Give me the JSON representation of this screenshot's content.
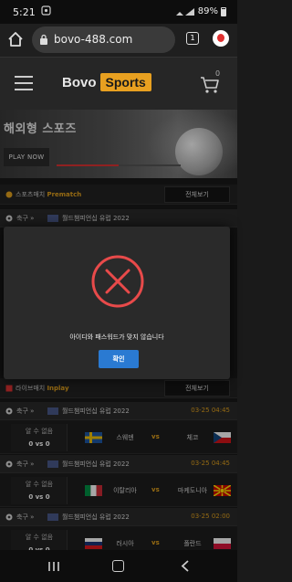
{
  "status_bar": {
    "time": "5:21",
    "battery": "89%"
  },
  "browser": {
    "url": "bovo-488.com",
    "tab_count": "1"
  },
  "header": {
    "logo_left": "Bovo",
    "logo_right": "Sports",
    "cart_count": "0"
  },
  "banner": {
    "title": "해외형 스포즈",
    "cta": "PLAY NOW",
    "progress": 0.5
  },
  "prematch": {
    "label": "스포츠매치",
    "label_en": "Prematch",
    "more": "전체보기",
    "league": {
      "sport": "축구",
      "name": "월드챔피언십 유럽 2022"
    }
  },
  "inplay": {
    "label": "라이브매치",
    "label_en": "Inplay",
    "more": "전체보기",
    "matches": [
      {
        "sport": "축구",
        "league": "월드챔피언십 유럽 2022",
        "time": "03-25 04:45",
        "status": "알 수 없음",
        "score": "0 vs 0",
        "home": "스웨덴",
        "vs": "vs",
        "away": "체코"
      },
      {
        "sport": "축구",
        "league": "월드챔피언십 유럽 2022",
        "time": "03-25 04:45",
        "status": "알 수 없음",
        "score": "0 vs 0",
        "home": "이탈리아",
        "vs": "vs",
        "away": "마케도니아"
      },
      {
        "sport": "축구",
        "league": "월드챔피언십 유럽 2022",
        "time": "03-25 02:00",
        "status": "알 수 없음",
        "score": "0 vs 0",
        "home": "러시아",
        "vs": "vs",
        "away": "폴란드"
      }
    ]
  },
  "modal": {
    "message": "아이디와 패스워드가 맞지 않습니다",
    "ok": "확인"
  },
  "colors": {
    "accent": "#e8a020",
    "error": "#e84a4a",
    "button": "#2a7ad2"
  }
}
